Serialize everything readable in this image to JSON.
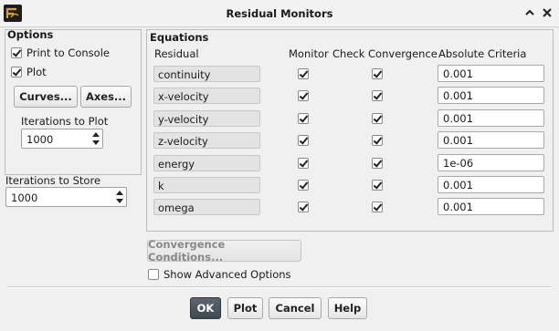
{
  "window": {
    "title": "Residual Monitors"
  },
  "options": {
    "title": "Options",
    "print_to_console": {
      "label": "Print to Console",
      "checked": true
    },
    "plot": {
      "label": "Plot",
      "checked": true
    },
    "curves_button": "Curves...",
    "axes_button": "Axes...",
    "iterations_to_plot": {
      "label": "Iterations to Plot",
      "value": "1000"
    },
    "iterations_to_store": {
      "label": "Iterations to Store",
      "value": "1000"
    }
  },
  "equations": {
    "title": "Equations",
    "headers": {
      "residual": "Residual",
      "monitor": "Monitor",
      "check_convergence": "Check Convergence",
      "absolute_criteria": "Absolute Criteria"
    },
    "rows": [
      {
        "name": "continuity",
        "monitor": true,
        "check": true,
        "criteria": "0.001"
      },
      {
        "name": "x-velocity",
        "monitor": true,
        "check": true,
        "criteria": "0.001"
      },
      {
        "name": "y-velocity",
        "monitor": true,
        "check": true,
        "criteria": "0.001"
      },
      {
        "name": "z-velocity",
        "monitor": true,
        "check": true,
        "criteria": "0.001"
      },
      {
        "name": "energy",
        "monitor": true,
        "check": true,
        "criteria": "1e-06"
      },
      {
        "name": "k",
        "monitor": true,
        "check": true,
        "criteria": "0.001"
      },
      {
        "name": "omega",
        "monitor": true,
        "check": true,
        "criteria": "0.001"
      }
    ]
  },
  "convergence_conditions_button": "Convergence Conditions...",
  "show_advanced": {
    "label": "Show Advanced Options",
    "checked": false
  },
  "footer": {
    "ok": "OK",
    "plot": "Plot",
    "cancel": "Cancel",
    "help": "Help"
  }
}
